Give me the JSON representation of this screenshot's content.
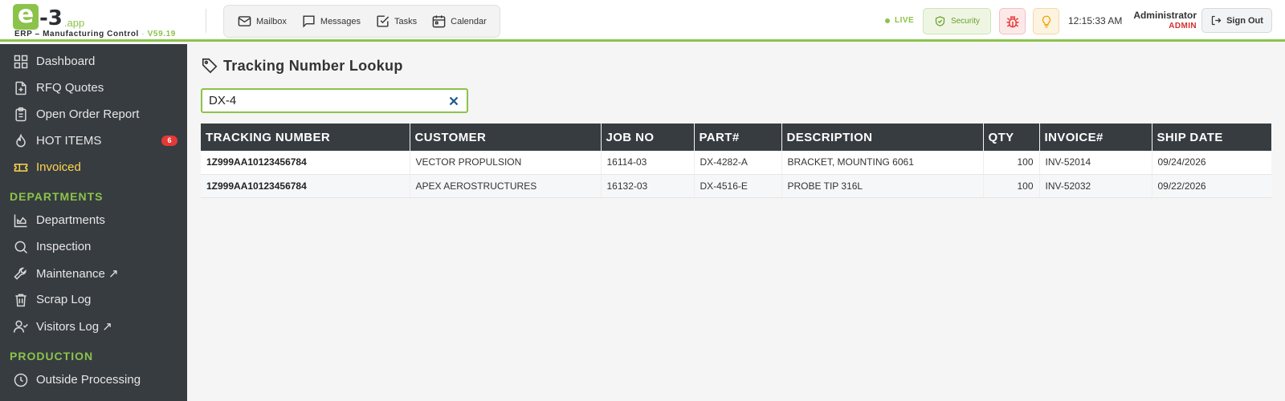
{
  "app": {
    "logo_e": "e",
    "logo_3": "-3",
    "logo_app": ".app",
    "subtitle": "ERP – Manufacturing Control",
    "subtitle_sep": "·",
    "version": "V59.19"
  },
  "quicknav": {
    "mailbox": "Mailbox",
    "messages": "Messages",
    "tasks": "Tasks",
    "calendar": "Calendar"
  },
  "status": {
    "live": "LIVE",
    "security": "Security",
    "clock": "12:15:33 AM"
  },
  "user": {
    "name": "Administrator",
    "role": "ADMIN",
    "signout": "Sign Out"
  },
  "colors": {
    "accent": "#8bc34a",
    "sidebar_bg": "#373c40",
    "active_item": "#ffd54f",
    "badge": "#e53935"
  },
  "sidebar": {
    "items": [
      {
        "label": "Dashboard",
        "icon": "grid-icon"
      },
      {
        "label": "RFQ Quotes",
        "icon": "file-plus-icon"
      },
      {
        "label": "Open Order Report",
        "icon": "clipboard-icon"
      },
      {
        "label": "HOT ITEMS",
        "icon": "flame-icon",
        "badge": "6"
      },
      {
        "label": "Invoiced",
        "icon": "ticket-icon",
        "active": true
      }
    ],
    "section_departments": "DEPARTMENTS",
    "departments": [
      {
        "label": "Departments",
        "icon": "area-chart-icon"
      },
      {
        "label": "Inspection",
        "icon": "search-icon"
      },
      {
        "label": "Maintenance ↗",
        "icon": "wrench-icon"
      },
      {
        "label": "Scrap Log",
        "icon": "trash-icon"
      },
      {
        "label": "Visitors Log ↗",
        "icon": "user-check-icon"
      }
    ],
    "section_production": "PRODUCTION",
    "production": [
      {
        "label": "Outside Processing",
        "icon": "clock-icon"
      }
    ]
  },
  "main": {
    "title": "Tracking Number Lookup",
    "search_value": "DX-4",
    "columns": [
      "TRACKING NUMBER",
      "CUSTOMER",
      "JOB NO",
      "PART#",
      "DESCRIPTION",
      "QTY",
      "INVOICE#",
      "SHIP DATE"
    ],
    "rows": [
      [
        "1Z999AA10123456784",
        "VECTOR PROPULSION",
        "16114-03",
        "DX-4282-A",
        "BRACKET, MOUNTING 6061",
        "100",
        "INV-52014",
        "09/24/2026"
      ],
      [
        "1Z999AA10123456784",
        "APEX AEROSTRUCTURES",
        "16132-03",
        "DX-4516-E",
        "PROBE TIP 316L",
        "100",
        "INV-52032",
        "09/22/2026"
      ]
    ]
  }
}
